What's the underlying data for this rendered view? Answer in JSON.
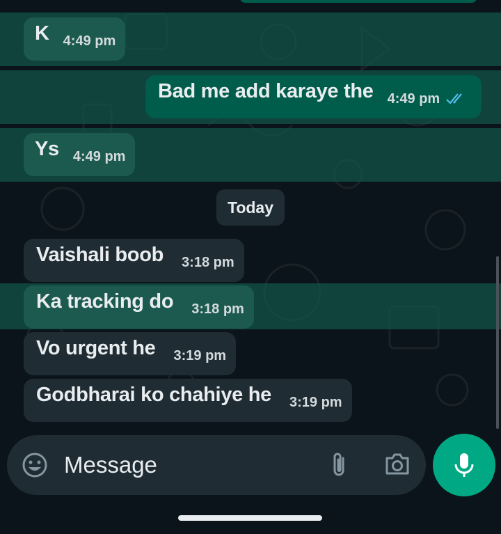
{
  "date_divider": "Today",
  "messages": [
    {
      "text": "K",
      "time": "4:49 pm",
      "direction": "incoming",
      "selected": true
    },
    {
      "text": "Bad me add karaye the",
      "time": "4:49 pm",
      "direction": "outgoing",
      "selected": true,
      "status": "read"
    },
    {
      "text": "Ys",
      "time": "4:49 pm",
      "direction": "incoming",
      "selected": true
    },
    {
      "text": "Vaishali boob",
      "time": "3:18 pm",
      "direction": "incoming",
      "selected": false
    },
    {
      "text": "Ka tracking do",
      "time": "3:18 pm",
      "direction": "incoming",
      "selected": true
    },
    {
      "text": "Vo urgent he",
      "time": "3:19 pm",
      "direction": "incoming",
      "selected": false
    },
    {
      "text": "Godbharai ko chahiye he",
      "time": "3:19 pm",
      "direction": "incoming",
      "selected": false
    }
  ],
  "composer": {
    "placeholder": "Message",
    "icons": [
      "emoji-icon",
      "paperclip-icon",
      "camera-icon",
      "microphone-icon"
    ]
  },
  "colors": {
    "background": "#0b141a",
    "incoming_bubble": "#1f2c34",
    "outgoing_bubble": "#005c4b",
    "selection_highlight": "#10564a",
    "accent": "#00a884",
    "read_ticks": "#53bdeb"
  }
}
